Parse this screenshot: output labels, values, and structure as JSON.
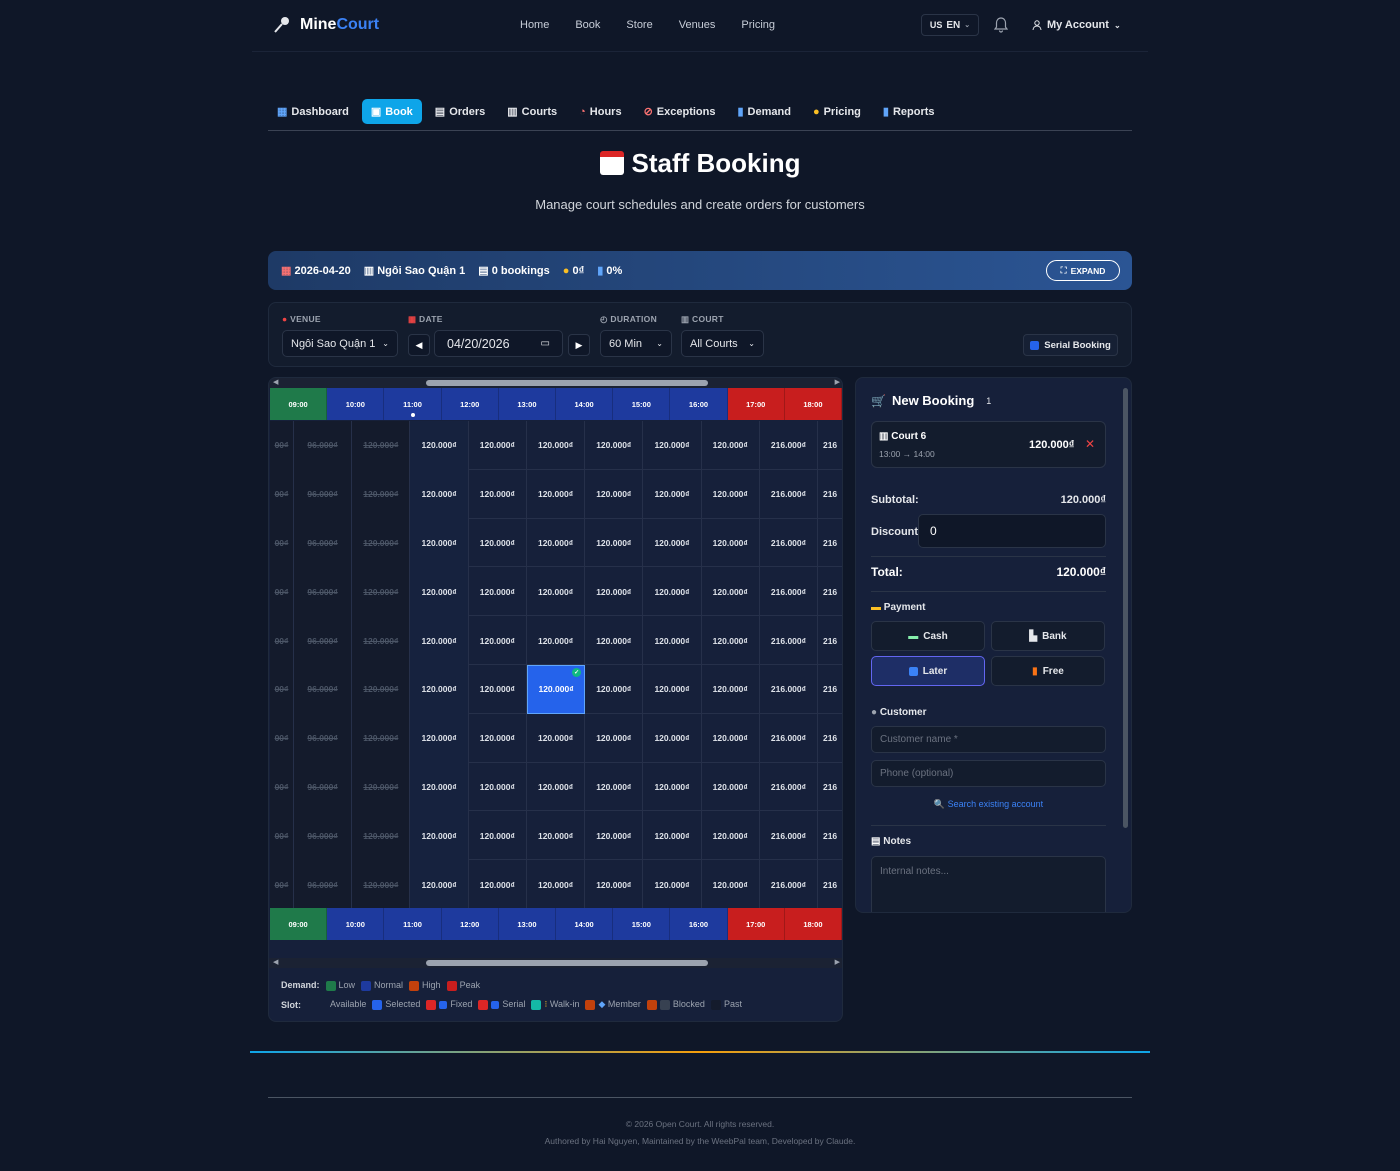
{
  "brand": {
    "mine": "Mine",
    "court": "Court"
  },
  "nav": {
    "links": [
      "Home",
      "Book",
      "Store",
      "Venues",
      "Pricing"
    ],
    "lang": "EN",
    "lang_flag": "US",
    "account": "My Account"
  },
  "tabs": [
    {
      "icon": "▦",
      "label": "Dashboard"
    },
    {
      "icon": "▣",
      "label": "Book"
    },
    {
      "icon": "▤",
      "label": "Orders"
    },
    {
      "icon": "▥",
      "label": "Courts"
    },
    {
      "icon": "◔",
      "label": "Hours"
    },
    {
      "icon": "⊘",
      "label": "Exceptions"
    },
    {
      "icon": "▮",
      "label": "Demand"
    },
    {
      "icon": "●",
      "label": "Pricing"
    },
    {
      "icon": "▮",
      "label": "Reports"
    }
  ],
  "page": {
    "title": "Staff Booking",
    "subtitle": "Manage court schedules and create orders for customers"
  },
  "summary": {
    "date": "2026-04-20",
    "venue": "Ngôi Sao Quận 1",
    "bookings": "0 bookings",
    "revenue": "0₫",
    "occupancy": "0%",
    "expand": "EXPAND"
  },
  "filters": {
    "venue_label": "VENUE",
    "venue_value": "Ngôi Sao Quận 1",
    "date_label": "DATE",
    "date_value": "04/20/2026",
    "duration_label": "DURATION",
    "duration_value": "60 Min",
    "court_label": "COURT",
    "court_value": "All Courts",
    "serial_button": "Serial Booking"
  },
  "grid": {
    "hours": [
      "09:00",
      "10:00",
      "11:00",
      "12:00",
      "13:00",
      "14:00",
      "15:00",
      "16:00",
      "17:00",
      "18:00"
    ],
    "hour_colors": [
      "#1f7a4a",
      "#1e3a9e",
      "#1e3a9e",
      "#1e3a9e",
      "#1e3a9e",
      "#1e3a9e",
      "#1e3a9e",
      "#1e3a9e",
      "#c81e1e",
      "#c81e1e"
    ],
    "cells": [
      "96.000₫",
      "120.000₫",
      "120.000₫",
      "120.000₫",
      "120.000₫",
      "120.000₫",
      "120.000₫",
      "120.000₫",
      "216.000₫"
    ],
    "first_cell": "00₫",
    "last_cell": "216",
    "rows": 10,
    "selected": {
      "row": 5,
      "col": 4
    }
  },
  "legend": {
    "demand_label": "Demand:",
    "demand": [
      {
        "label": "Low",
        "color": "#1f7a4a"
      },
      {
        "label": "Normal",
        "color": "#1e3a9e"
      },
      {
        "label": "High",
        "color": "#c2410c"
      },
      {
        "label": "Peak",
        "color": "#c81e1e"
      }
    ],
    "slot_label": "Slot:",
    "slots": [
      "Available",
      "Selected",
      "Fixed",
      "Serial",
      "Walk-in",
      "Member",
      "Blocked",
      "Past"
    ]
  },
  "booking": {
    "title": "New Booking",
    "count": "1",
    "item_court": "Court 6",
    "item_time": "13:00 → 14:00",
    "item_price": "120.000₫",
    "subtotal_label": "Subtotal:",
    "subtotal": "120.000₫",
    "discount_label": "Discount:",
    "discount": "0",
    "total_label": "Total:",
    "total": "120.000₫",
    "payment_label": "Payment",
    "payments": [
      "Cash",
      "Bank",
      "Later",
      "Free"
    ],
    "customer_label": "Customer",
    "name_placeholder": "Customer name *",
    "phone_placeholder": "Phone (optional)",
    "search_link": "Search existing account",
    "notes_label": "Notes",
    "notes_placeholder": "Internal notes..."
  },
  "footer": {
    "copyright": "© 2026 Open Court. All rights reserved.",
    "credits": "Authored by Hai Nguyen, Maintained by the WeebPal team, Developed by Claude."
  }
}
